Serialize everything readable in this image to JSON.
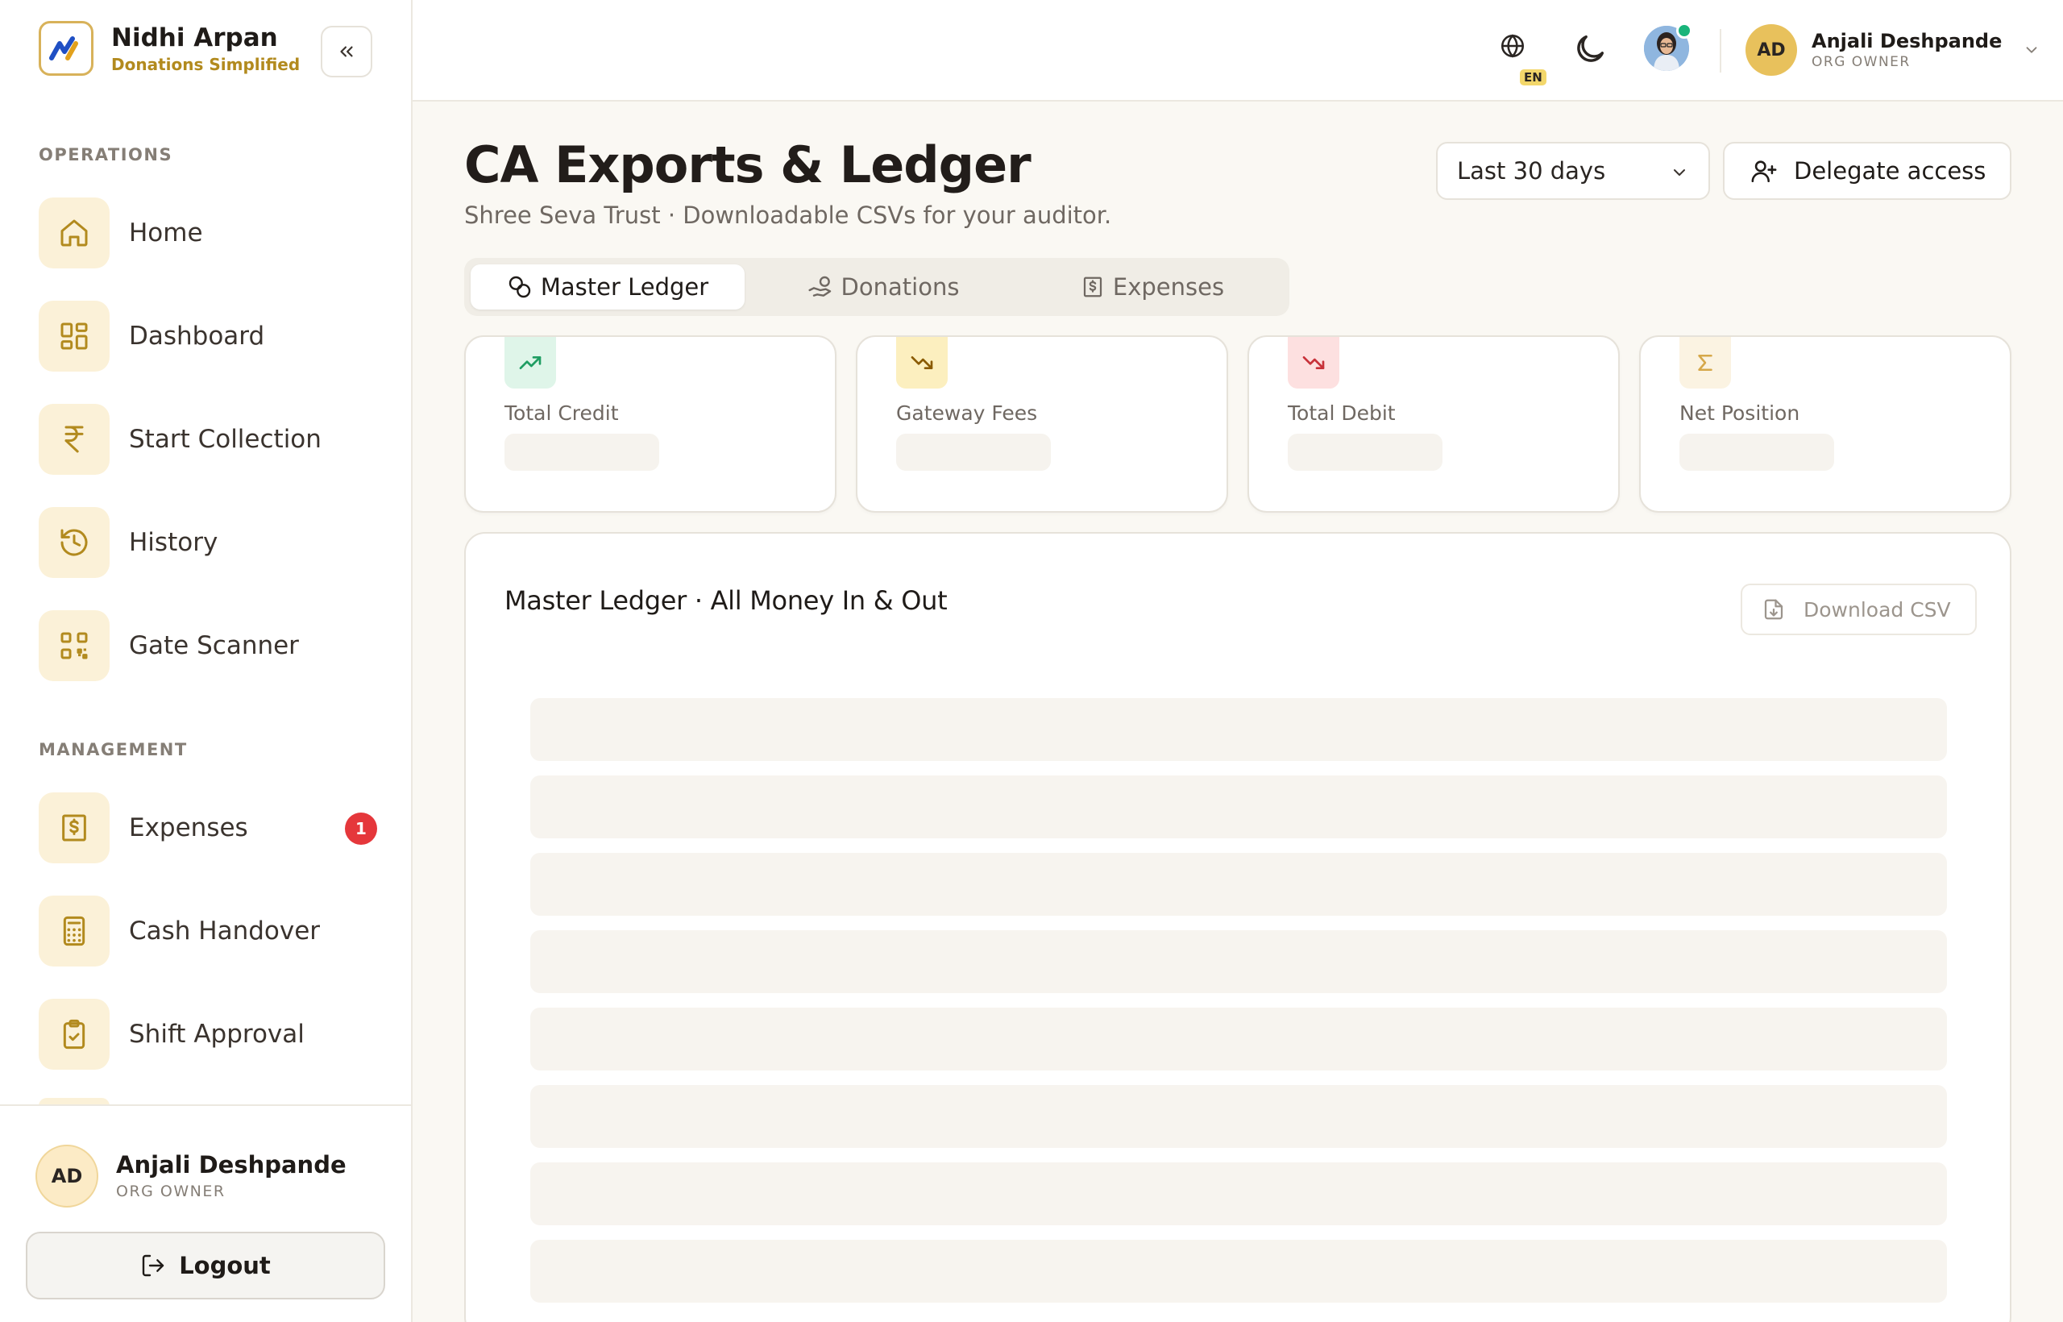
{
  "brand": {
    "name": "Nidhi Arpan",
    "tagline": "Donations Simplified"
  },
  "sidebar": {
    "sections": [
      {
        "label": "OPERATIONS"
      },
      {
        "label": "MANAGEMENT"
      }
    ],
    "items": [
      {
        "label": "Home",
        "icon": "home-icon"
      },
      {
        "label": "Dashboard",
        "icon": "dashboard-icon"
      },
      {
        "label": "Start Collection",
        "icon": "rupee-icon"
      },
      {
        "label": "History",
        "icon": "history-icon"
      },
      {
        "label": "Gate Scanner",
        "icon": "qr-code-icon"
      },
      {
        "label": "Expenses",
        "icon": "receipt-icon",
        "badge": "1"
      },
      {
        "label": "Cash Handover",
        "icon": "calculator-icon"
      },
      {
        "label": "Shift Approval",
        "icon": "clipboard-check-icon"
      }
    ],
    "footer_user": {
      "initials": "AD",
      "name": "Anjali Deshpande",
      "role": "ORG OWNER"
    },
    "logout_label": "Logout"
  },
  "header": {
    "language": "EN",
    "user": {
      "initials": "AD",
      "name": "Anjali Deshpande",
      "role": "ORG OWNER"
    }
  },
  "page": {
    "title": "CA Exports & Ledger",
    "subtitle": "Shree Seva Trust · Downloadable CSVs for your auditor.",
    "range": "Last 30 days",
    "delegate_label": "Delegate access"
  },
  "tabs": [
    {
      "label": "Master Ledger",
      "active": true
    },
    {
      "label": "Donations",
      "active": false
    },
    {
      "label": "Expenses",
      "active": false
    }
  ],
  "stats": [
    {
      "label": "Total Credit",
      "icon": "trending-up-icon",
      "accent": "#1f9d62",
      "bg": "#dff5e9"
    },
    {
      "label": "Gateway Fees",
      "icon": "trending-down-icon",
      "accent": "#8a5a00",
      "bg": "#fcefbf"
    },
    {
      "label": "Total Debit",
      "icon": "trending-down-icon",
      "accent": "#c8323a",
      "bg": "#fde0e0"
    },
    {
      "label": "Net Position",
      "icon": "sigma-icon",
      "accent": "#d6a84a",
      "bg": "#fbf3e2"
    }
  ],
  "ledger": {
    "title": "Master Ledger · All Money In & Out",
    "download_label": "Download CSV"
  },
  "colors": {
    "accent": "#b28a1e",
    "badge": "#e5373b",
    "online": "#19b47a"
  }
}
